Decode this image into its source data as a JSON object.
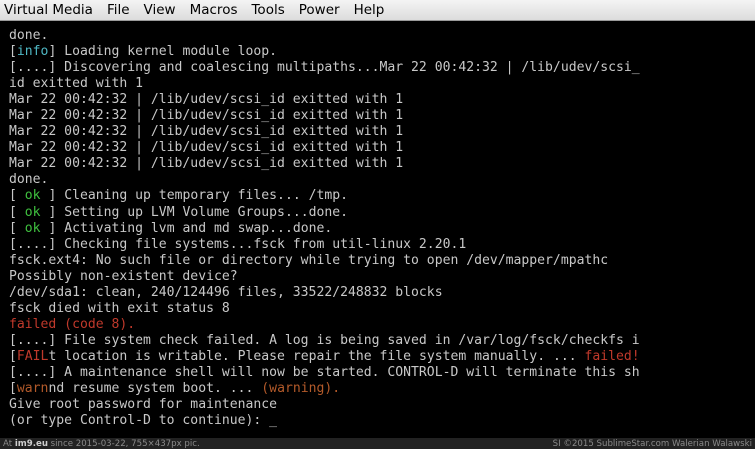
{
  "menu": [
    "Virtual Media",
    "File",
    "View",
    "Macros",
    "Tools",
    "Power",
    "Help"
  ],
  "console": {
    "lines": [
      [
        {
          "t": "done.",
          "c": "plain"
        }
      ],
      [
        {
          "t": "[",
          "c": "plain"
        },
        {
          "t": "info",
          "c": "info"
        },
        {
          "t": "] Loading kernel module loop.",
          "c": "plain"
        }
      ],
      [
        {
          "t": "[....] Discovering and coalescing multipaths...Mar 22 00:42:32 | /lib/udev/scsi_",
          "c": "plain"
        }
      ],
      [
        {
          "t": "id exitted with 1",
          "c": "plain"
        }
      ],
      [
        {
          "t": "Mar 22 00:42:32 | /lib/udev/scsi_id exitted with 1",
          "c": "plain"
        }
      ],
      [
        {
          "t": "Mar 22 00:42:32 | /lib/udev/scsi_id exitted with 1",
          "c": "plain"
        }
      ],
      [
        {
          "t": "Mar 22 00:42:32 | /lib/udev/scsi_id exitted with 1",
          "c": "plain"
        }
      ],
      [
        {
          "t": "Mar 22 00:42:32 | /lib/udev/scsi_id exitted with 1",
          "c": "plain"
        }
      ],
      [
        {
          "t": "Mar 22 00:42:32 | /lib/udev/scsi_id exitted with 1",
          "c": "plain"
        }
      ],
      [
        {
          "t": "done.",
          "c": "plain"
        }
      ],
      [
        {
          "t": "[ ",
          "c": "plain"
        },
        {
          "t": "ok",
          "c": "ok"
        },
        {
          "t": " ] Cleaning up temporary files... /tmp.",
          "c": "plain"
        }
      ],
      [
        {
          "t": "[ ",
          "c": "plain"
        },
        {
          "t": "ok",
          "c": "ok"
        },
        {
          "t": " ] Setting up LVM Volume Groups...done.",
          "c": "plain"
        }
      ],
      [
        {
          "t": "[ ",
          "c": "plain"
        },
        {
          "t": "ok",
          "c": "ok"
        },
        {
          "t": " ] Activating lvm and md swap...done.",
          "c": "plain"
        }
      ],
      [
        {
          "t": "[....] Checking file systems...fsck from util-linux 2.20.1",
          "c": "plain"
        }
      ],
      [
        {
          "t": "fsck.ext4: No such file or directory while trying to open /dev/mapper/mpathc",
          "c": "plain"
        }
      ],
      [
        {
          "t": "Possibly non-existent device?",
          "c": "plain"
        }
      ],
      [
        {
          "t": "/dev/sda1: clean, 240/124496 files, 33522/248832 blocks",
          "c": "plain"
        }
      ],
      [
        {
          "t": "fsck died with exit status 8",
          "c": "plain"
        }
      ],
      [
        {
          "t": "failed (code 8).",
          "c": "failed"
        }
      ],
      [
        {
          "t": "[....] File system check failed. A log is being saved in /var/log/fsck/checkfs i",
          "c": "plain"
        }
      ],
      [
        {
          "t": "[",
          "c": "plain"
        },
        {
          "t": "FAIL",
          "c": "failed"
        },
        {
          "t": "t location is writable. Please repair the file system manually. ... ",
          "c": "plain"
        },
        {
          "t": "failed!",
          "c": "failed"
        }
      ],
      [
        {
          "t": "[....] A maintenance shell will now be started. CONTROL-D will terminate this sh",
          "c": "plain"
        }
      ],
      [
        {
          "t": "[",
          "c": "plain"
        },
        {
          "t": "warn",
          "c": "warn"
        },
        {
          "t": "nd resume system boot. ... ",
          "c": "plain"
        },
        {
          "t": "(warning).",
          "c": "warn"
        }
      ],
      [
        {
          "t": "Give root password for maintenance",
          "c": "plain"
        }
      ],
      [
        {
          "t": "(or type Control-D to continue): ",
          "c": "plain"
        },
        {
          "t": "_",
          "c": "cursor"
        }
      ]
    ]
  },
  "status": {
    "left_prefix": "At ",
    "left_site": "im9.eu",
    "left_rest": " since 2015-03-22, 755×437px pic.",
    "right": "SI ©2015 SublimeStar.com Walerian Walawski"
  }
}
